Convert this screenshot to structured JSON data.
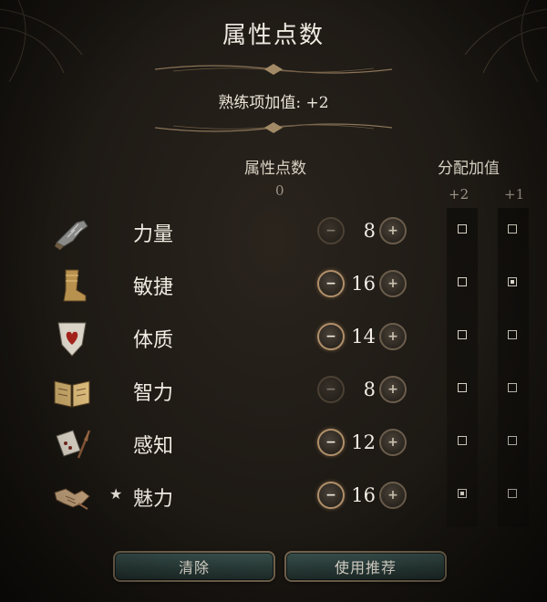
{
  "title": "属性点数",
  "proficiency_bonus": "熟练项加值: +2",
  "points_header": "属性点数",
  "points_remaining": "0",
  "allocation_header": "分配加值",
  "bonus_columns": [
    "+2",
    "+1"
  ],
  "attributes": [
    {
      "name": "力量",
      "icon": "gauntlet-icon",
      "value": "8",
      "starred": false,
      "minus_active": false,
      "bonus_plus2": false,
      "bonus_plus1": false
    },
    {
      "name": "敏捷",
      "icon": "boot-icon",
      "value": "16",
      "starred": false,
      "minus_active": true,
      "bonus_plus2": false,
      "bonus_plus1": true
    },
    {
      "name": "体质",
      "icon": "heart-shield-icon",
      "value": "14",
      "starred": false,
      "minus_active": true,
      "bonus_plus2": false,
      "bonus_plus1": false
    },
    {
      "name": "智力",
      "icon": "open-book-icon",
      "value": "8",
      "starred": false,
      "minus_active": false,
      "bonus_plus2": false,
      "bonus_plus1": false
    },
    {
      "name": "感知",
      "icon": "scroll-quill-icon",
      "value": "12",
      "starred": false,
      "minus_active": true,
      "bonus_plus2": false,
      "bonus_plus1": false
    },
    {
      "name": "魅力",
      "icon": "handshake-icon",
      "value": "16",
      "starred": true,
      "minus_active": true,
      "bonus_plus2": true,
      "bonus_plus1": false
    }
  ],
  "star_symbol": "★",
  "buttons": {
    "clear": "清除",
    "recommend": "使用推荐"
  }
}
